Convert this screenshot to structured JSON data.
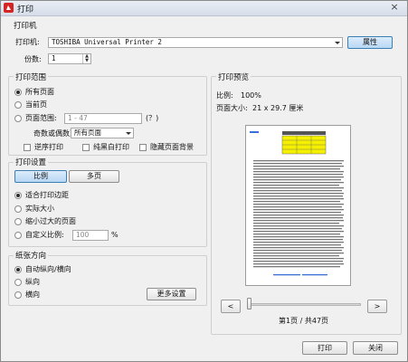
{
  "window": {
    "title": "打印",
    "close_glyph": "×"
  },
  "printer_group": {
    "title": "打印机",
    "printer_label": "打印机:",
    "printer_value": "TOSHIBA Universal Printer 2",
    "properties_button": "属性",
    "copies_label": "份数:",
    "copies_value": "1"
  },
  "range_group": {
    "title": "打印范围",
    "options": [
      "所有页面",
      "当前页",
      "页面范围:"
    ],
    "selected_index": 0,
    "range_placeholder": "1 - 47",
    "range_help": "(？)",
    "odd_even_label": "奇数或偶数页",
    "odd_even_value": "所有页面",
    "checkboxes": [
      "逆序打印",
      "纯黑白打印",
      "隐藏页面背景"
    ]
  },
  "settings_group": {
    "title": "打印设置",
    "tabs": [
      "比例",
      "多页"
    ],
    "active_tab": 0,
    "options": [
      "适合打印边距",
      "实际大小",
      "缩小过大的页面",
      "自定义比例:"
    ],
    "selected_index": 0,
    "scale_value": "100",
    "scale_unit": "%"
  },
  "orientation_group": {
    "title": "纸张方向",
    "options": [
      "自动纵向/横向",
      "纵向",
      "横向"
    ],
    "selected_index": 0,
    "more_button": "更多设置"
  },
  "preview": {
    "title": "打印预览",
    "scale_label": "比例:",
    "scale_value": "100%",
    "page_size_label": "页面大小:",
    "page_size_value": "21 x 29.7 厘米",
    "prev_glyph": "<",
    "next_glyph": ">",
    "page_indicator": "第1页 / 共47页",
    "slider_position": 0.0
  },
  "footer": {
    "print_button": "打印",
    "close_button": "关闭"
  },
  "colors": {
    "accent": "#3c7fb1",
    "title_icon": "#d42424",
    "table_highlight": "#f4f000"
  }
}
